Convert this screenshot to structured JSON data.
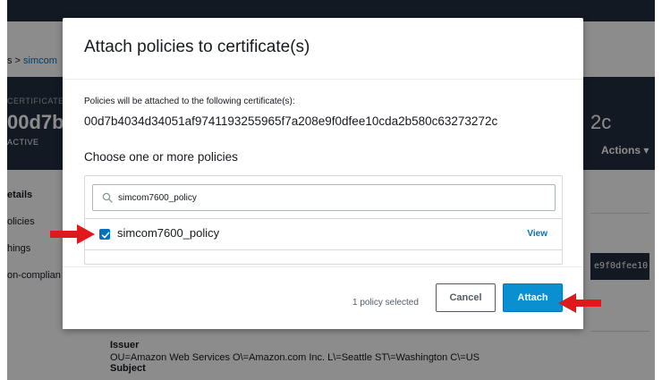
{
  "background": {
    "breadcrumb_prefix": "s >",
    "breadcrumb_link": "simcom",
    "cert_label": "CERTIFICATE",
    "cert_id_partial": "00d7b4",
    "cert_id_tail": "2c",
    "status": "ACTIVE",
    "actions_label": "Actions ▾",
    "nav": [
      "etails",
      "olicies",
      "hings",
      "on-complian"
    ],
    "code_snippet": "e9f0dfee10",
    "issuer_heading": "Issuer",
    "issuer_value": "OU=Amazon Web Services O\\=Amazon.com Inc. L\\=Seattle ST\\=Washington C\\=US",
    "subject_heading": "Subject"
  },
  "modal": {
    "title": "Attach policies to certificate(s)",
    "info_label": "Policies will be attached to the following certificate(s):",
    "certificate_id": "00d7b4034d34051af9741193255965f7a208e9f0dfee10cda2b580c63273272c",
    "choose_label": "Choose one or more policies",
    "search": {
      "value": "simcom7600_policy",
      "icon": "search-icon"
    },
    "policies": [
      {
        "name": "simcom7600_policy",
        "checked": true,
        "action": "View"
      }
    ],
    "footer": {
      "selected_text": "1 policy selected",
      "cancel_label": "Cancel",
      "attach_label": "Attach"
    }
  },
  "colors": {
    "accent": "#0073bb",
    "attach_button": "#0a8fd1",
    "annotation_arrow": "#e0171b",
    "header_dark": "#232f3e"
  }
}
